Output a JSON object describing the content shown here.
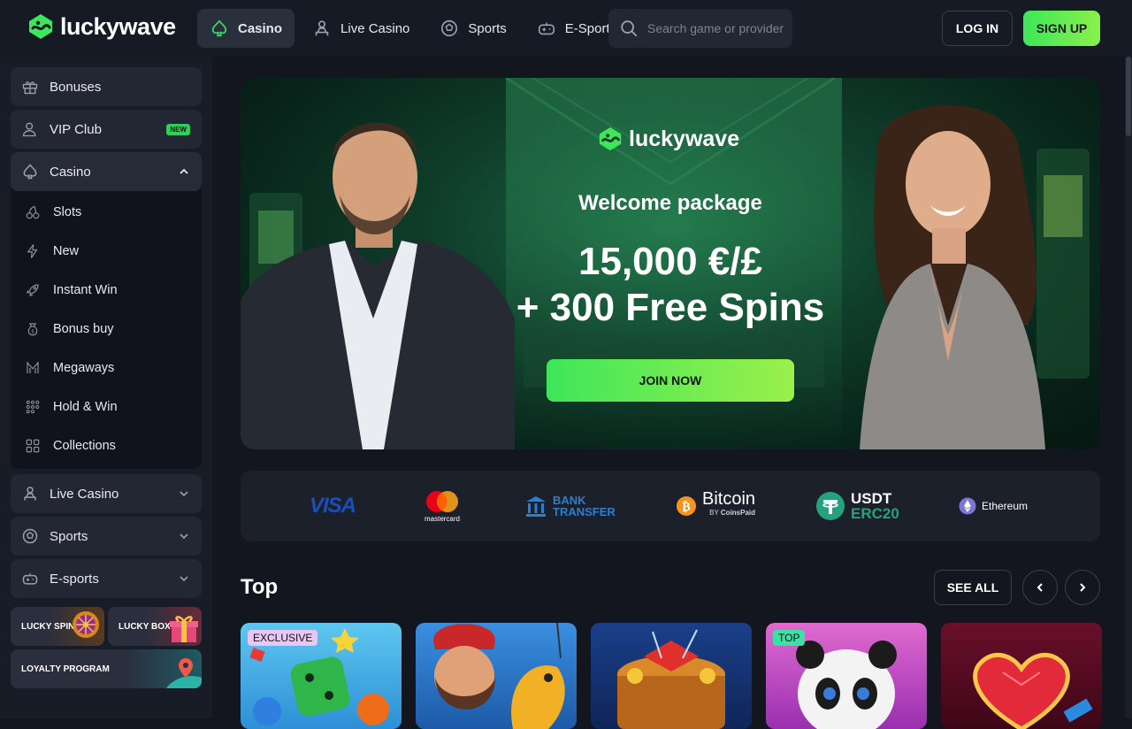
{
  "header": {
    "logo_part1": "lucky",
    "logo_part2": "wave",
    "nav": [
      {
        "label": "Casino",
        "icon": "spade-icon",
        "active": true
      },
      {
        "label": "Live Casino",
        "icon": "dealer-icon"
      },
      {
        "label": "Sports",
        "icon": "soccer-ball-icon"
      },
      {
        "label": "E-Sports",
        "icon": "gamepad-icon"
      }
    ],
    "search_placeholder": "Search game or provider",
    "login_label": "LOG IN",
    "signup_label": "SIGN UP"
  },
  "sidebar": {
    "bonuses": "Bonuses",
    "vip": "VIP Club",
    "vip_badge": "NEW",
    "casino": "Casino",
    "casino_items": [
      "Slots",
      "New",
      "Instant Win",
      "Bonus buy",
      "Megaways",
      "Hold & Win",
      "Collections"
    ],
    "live_casino": "Live Casino",
    "sports": "Sports",
    "esports": "E-sports",
    "promo_lucky_spin": "LUCKY SPIN",
    "promo_lucky_box": "LUCKY BOX",
    "promo_loyalty": "LOYALTY PROGRAM"
  },
  "hero": {
    "logo_part1": "lucky",
    "logo_part2": "wave",
    "subtitle": "Welcome package",
    "amount_line1": "15,000 €/£",
    "amount_line2": "+ 300 Free Spins",
    "cta": "JOIN NOW"
  },
  "payments": {
    "visa": "VISA",
    "mastercard": "mastercard",
    "bank_line1": "BANK",
    "bank_line2": "TRANSFER",
    "bitcoin": "Bitcoin",
    "bitcoin_by": "BY",
    "coinspaid": "CoinsPaid",
    "usdt_line1": "USDT",
    "usdt_line2": "ERC20",
    "ethereum": "Ethereum"
  },
  "top_section": {
    "title": "Top",
    "see_all": "SEE ALL",
    "games": [
      {
        "tag": "EXCLUSIVE"
      },
      {
        "tag": ""
      },
      {
        "tag": ""
      },
      {
        "tag": "TOP"
      },
      {
        "tag": ""
      }
    ]
  },
  "colors": {
    "accent_green": "#3ee65a",
    "background": "#13161f",
    "panel": "#232733"
  }
}
